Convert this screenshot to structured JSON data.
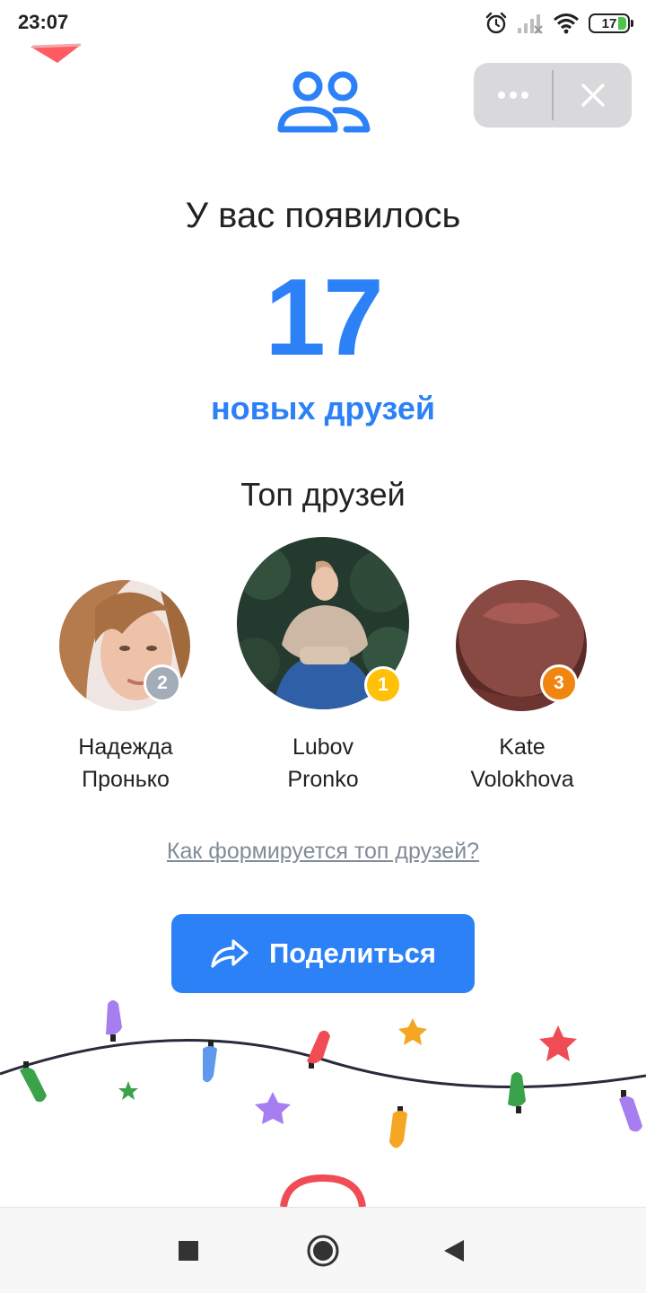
{
  "status_bar": {
    "time": "23:07",
    "battery_level": "17",
    "icons": [
      "alarm-icon",
      "signal-icon",
      "wifi-icon",
      "battery-icon"
    ]
  },
  "header": {
    "icon": "friends-icon",
    "more_icon": "more-dots-icon",
    "close_icon": "close-icon"
  },
  "summary": {
    "headline": "У вас появилось",
    "count": "17",
    "count_label": "новых друзей"
  },
  "top_friends": {
    "title": "Топ друзей",
    "friends": [
      {
        "rank": "2",
        "first_name": "Надежда",
        "last_name": "Пронько",
        "badge_color": "#a3adb8"
      },
      {
        "rank": "1",
        "first_name": "Lubov",
        "last_name": "Pronko",
        "badge_color": "#ffc107"
      },
      {
        "rank": "3",
        "first_name": "Kate",
        "last_name": "Volokhova",
        "badge_color": "#f0850f"
      }
    ]
  },
  "info_link": "Как формируется топ друзей?",
  "share_button": {
    "label": "Поделиться",
    "icon": "share-arrow-icon"
  },
  "nav_bar": {
    "icons": [
      "recent-apps-icon",
      "home-icon",
      "back-icon"
    ]
  },
  "colors": {
    "accent": "#2d81f7",
    "text": "#222222",
    "link": "#818c99",
    "capsule": "#d9d9db"
  }
}
